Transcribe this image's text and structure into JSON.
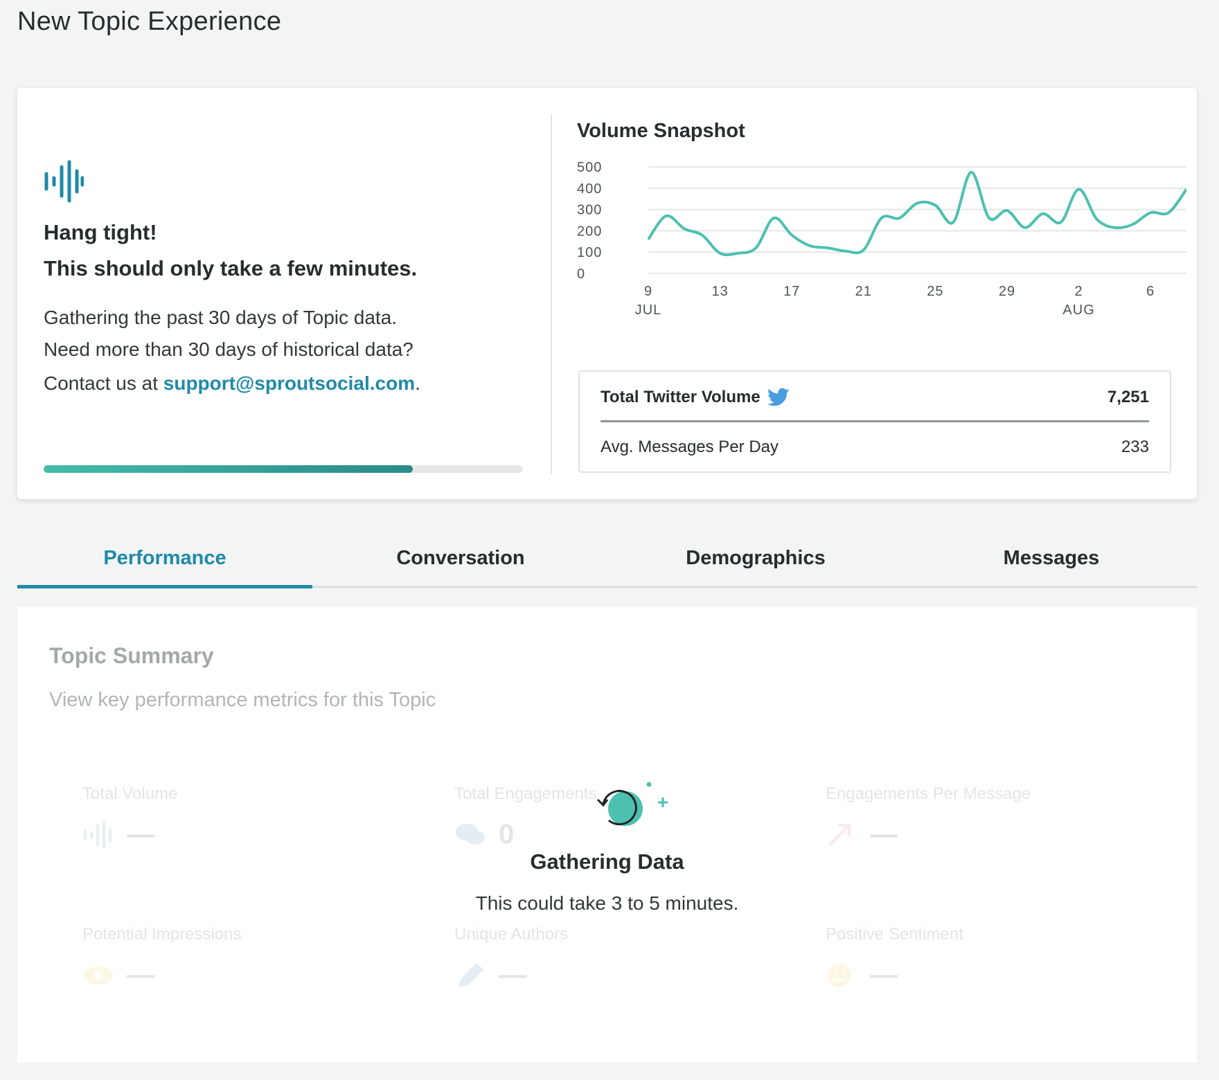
{
  "page": {
    "title": "New Topic Experience"
  },
  "loading": {
    "heading": "Hang tight!",
    "subheading": "This should only take a few minutes.",
    "line1": "Gathering the past 30 days of Topic data.",
    "line2": "Need more than 30 days of historical data?",
    "line3_prefix": "Contact us at ",
    "support_email": "support@sproutsocial.com",
    "line3_suffix": ".",
    "progress_fraction": 0.77,
    "icon": "waveform-icon"
  },
  "snapshot": {
    "title": "Volume Snapshot",
    "stats": {
      "total_label": "Total Twitter Volume",
      "total_value": "7,251",
      "avg_label": "Avg. Messages Per Day",
      "avg_value": "233",
      "twitter_icon": "twitter-bird-icon"
    }
  },
  "chart_data": {
    "type": "line",
    "x": [
      "Jul 9",
      "Jul 10",
      "Jul 11",
      "Jul 12",
      "Jul 13",
      "Jul 14",
      "Jul 15",
      "Jul 16",
      "Jul 17",
      "Jul 18",
      "Jul 19",
      "Jul 20",
      "Jul 21",
      "Jul 22",
      "Jul 23",
      "Jul 24",
      "Jul 25",
      "Jul 26",
      "Jul 27",
      "Jul 28",
      "Jul 29",
      "Jul 30",
      "Jul 31",
      "Aug 1",
      "Aug 2",
      "Aug 3",
      "Aug 4",
      "Aug 5",
      "Aug 6",
      "Aug 7",
      "Aug 8"
    ],
    "series": [
      {
        "values": [
          160,
          270,
          210,
          180,
          95,
          95,
          120,
          260,
          180,
          130,
          120,
          105,
          110,
          260,
          260,
          330,
          320,
          240,
          475,
          260,
          295,
          215,
          280,
          240,
          395,
          255,
          215,
          230,
          285,
          285,
          395
        ]
      }
    ],
    "ylim": [
      0,
      500
    ],
    "yticks": [
      "500",
      "400",
      "300",
      "200",
      "100",
      "0"
    ],
    "xticks": [
      {
        "top": "9",
        "bottom": "JUL"
      },
      {
        "top": "13",
        "bottom": ""
      },
      {
        "top": "17",
        "bottom": ""
      },
      {
        "top": "21",
        "bottom": ""
      },
      {
        "top": "25",
        "bottom": ""
      },
      {
        "top": "29",
        "bottom": ""
      },
      {
        "top": "2",
        "bottom": "AUG"
      },
      {
        "top": "6",
        "bottom": ""
      }
    ],
    "grid": true,
    "line_color": "#4dc0b0"
  },
  "tabs": [
    {
      "label": "Performance",
      "active": true
    },
    {
      "label": "Conversation",
      "active": false
    },
    {
      "label": "Demographics",
      "active": false
    },
    {
      "label": "Messages",
      "active": false
    }
  ],
  "summary": {
    "title": "Topic Summary",
    "subtitle": "View key performance metrics for this Topic",
    "metrics": [
      {
        "label": "Total Volume",
        "value": "—",
        "icon": "waveform-icon"
      },
      {
        "label": "Total Engagements",
        "value": "0",
        "icon": "speech-bubbles-icon"
      },
      {
        "label": "Engagements Per Message",
        "value": "—",
        "icon": "trend-arrow-icon"
      },
      {
        "label": "Potential Impressions",
        "value": "—",
        "icon": "eye-icon"
      },
      {
        "label": "Unique Authors",
        "value": "—",
        "icon": "pencil-icon"
      },
      {
        "label": "Positive Sentiment",
        "value": "—",
        "icon": "smiley-icon"
      }
    ],
    "overlay": {
      "title": "Gathering Data",
      "subtitle": "This could take 3 to 5 minutes.",
      "icon": "refresh-circle-icon"
    }
  },
  "colors": {
    "accent": "#1f8aa6",
    "teal": "#4dc0b0",
    "background": "#f3f4f4"
  }
}
